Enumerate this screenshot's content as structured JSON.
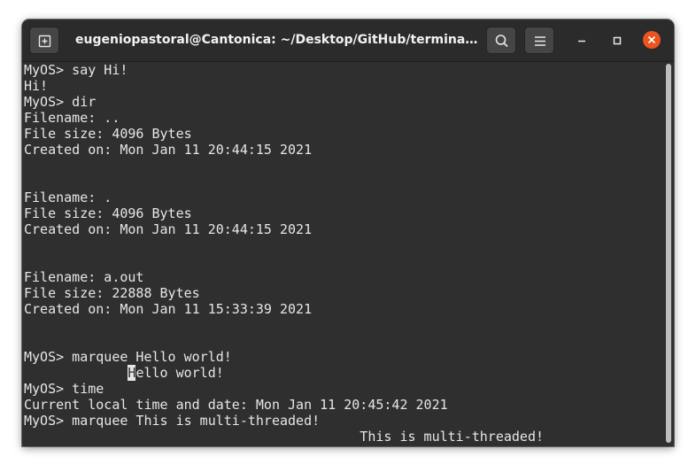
{
  "window": {
    "title": "eugeniopastoral@Cantonica: ~/Desktop/GitHub/terminal-sim..."
  },
  "icons": {
    "new_tab": "new-tab-icon",
    "search": "search-icon",
    "menu": "hamburger-menu-icon",
    "minimize": "minimize-icon",
    "maximize": "maximize-icon",
    "close": "close-icon"
  },
  "colors": {
    "background": "#2f2f2f",
    "foreground": "#e6e6e6",
    "close_accent": "#e95420"
  },
  "terminal": {
    "lines": [
      "MyOS> say Hi!",
      "Hi!",
      "MyOS> dir",
      "Filename: ..",
      "File size: 4096 Bytes",
      "Created on: Mon Jan 11 20:44:15 2021",
      "",
      "",
      "Filename: .",
      "File size: 4096 Bytes",
      "Created on: Mon Jan 11 20:44:15 2021",
      "",
      "",
      "Filename: a.out",
      "File size: 22888 Bytes",
      "Created on: Mon Jan 11 15:33:39 2021",
      "",
      "",
      "MyOS> marquee Hello world!",
      "",
      "MyOS> time",
      "Current local time and date: Mon Jan 11 20:45:42 2021",
      "MyOS> marquee This is multi-threaded!",
      "                                          This is multi-threaded!"
    ],
    "marquee_line": {
      "indent": "             ",
      "cursor_char": "H",
      "rest": "ello world!"
    }
  }
}
